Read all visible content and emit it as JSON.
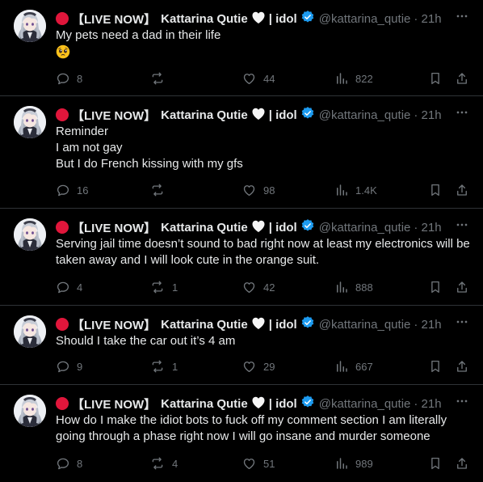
{
  "author": {
    "live_badge": "【LIVE NOW】",
    "name": "Kattarina Qutie",
    "name_suffix": "| idol",
    "handle": "@kattarina_qutie",
    "time": "· 21h"
  },
  "colors": {
    "live_dot": "#e0163b",
    "verified": "#1d9bf0",
    "muted": "#71767b",
    "text": "#e7e9ea",
    "divider": "#2f3336"
  },
  "icons": [
    "live-dot-icon",
    "white-heart-icon",
    "verified-badge-icon",
    "more-icon",
    "reply-icon",
    "retweet-icon",
    "like-icon",
    "views-icon",
    "bookmark-icon",
    "share-icon"
  ],
  "tweets": [
    {
      "text": "My pets need a dad in their life",
      "emoji": "pleading-face-emoji",
      "replies": "8",
      "retweets": "",
      "likes": "44",
      "views": "822"
    },
    {
      "text": "Reminder\nI am not gay\nBut I do French kissing with my gfs",
      "replies": "16",
      "retweets": "",
      "likes": "98",
      "views": "1.4K"
    },
    {
      "text": "Serving jail time doesn’t sound to bad right now at least my electronics will be taken away and I will look cute in the orange suit.",
      "replies": "4",
      "retweets": "1",
      "likes": "42",
      "views": "888"
    },
    {
      "text": "Should I take the car out it’s 4 am",
      "replies": "9",
      "retweets": "1",
      "likes": "29",
      "views": "667"
    },
    {
      "text": "How do I make the idiot bots to fuck off my comment section I am literally going through a phase right now I will go insane and murder someone",
      "replies": "8",
      "retweets": "4",
      "likes": "51",
      "views": "989"
    }
  ]
}
